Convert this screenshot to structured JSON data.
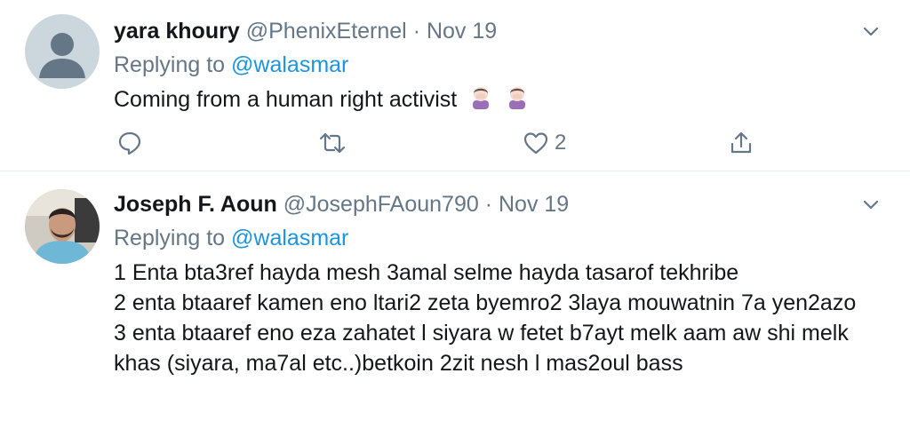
{
  "tweets": [
    {
      "name": "yara khoury",
      "handle": "@PhenixEternel",
      "separator": "·",
      "date": "Nov 19",
      "replying_prefix": "Replying to",
      "replying_handle": "@walasmar",
      "text": "Coming from a human right activist",
      "emoji": [
        "face-palm-emoji",
        "face-palm-emoji"
      ],
      "like_count": "2"
    },
    {
      "name": "Joseph F. Aoun",
      "handle": "@JosephFAoun790",
      "separator": "·",
      "date": "Nov 19",
      "replying_prefix": "Replying to",
      "replying_handle": "@walasmar",
      "text": "1 Enta bta3ref hayda mesh 3amal selme hayda tasarof tekhribe\n2 enta btaaref kamen eno ltari2 zeta byemro2 3laya mouwatnin 7a yen2azo\n3 enta btaaref eno eza zahatet l siyara w fetet b7ayt melk aam aw shi melk khas (siyara, ma7al etc..)betkoin 2zit nesh l mas2oul bass"
    }
  ],
  "colors": {
    "text": "#14171a",
    "muted": "#657786",
    "link": "#1b95e0",
    "divider": "#e6ecf0"
  }
}
